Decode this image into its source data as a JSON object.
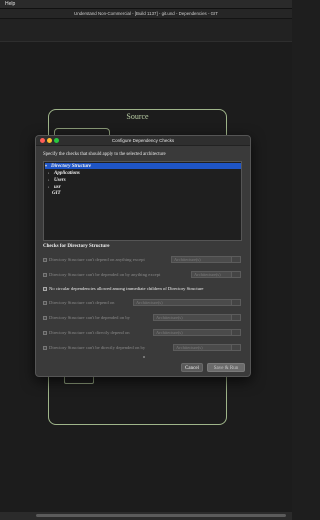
{
  "menubar": {
    "menu_help": "Help"
  },
  "window": {
    "title": "Understand Non-Commercial - [Build 1137] - git.und - Dependencies - GIT"
  },
  "canvas": {
    "source_label": "Source"
  },
  "dialog": {
    "title": "Configure Dependency Checks",
    "instruction": "Specify the checks that should apply to the selected architecture",
    "tree": [
      {
        "label": "Directory Structure",
        "expander": "▾",
        "selected": true
      },
      {
        "label": "Applications",
        "expander": "›",
        "selected": false
      },
      {
        "label": "Users",
        "expander": "›",
        "selected": false
      },
      {
        "label": "usr",
        "expander": "›",
        "selected": false
      },
      {
        "label": "GIT",
        "expander": "",
        "selected": false
      }
    ],
    "checks_title": "Checks for Directory Structure",
    "checks": [
      {
        "label": "Directory Structure can't depend on anything except",
        "enabled": false,
        "combo": "Architecture(s)"
      },
      {
        "label": "Directory Structure can't be depended on by anything except",
        "enabled": false,
        "combo": "Architecture(s)"
      },
      {
        "label": "No circular dependencies allowed among immediate children of Directory Structure",
        "enabled": true,
        "combo": ""
      },
      {
        "label": "Directory Structure can't depend on",
        "enabled": false,
        "combo": "Architecture(s)"
      },
      {
        "label": "Directory Structure can't be depended on by",
        "enabled": false,
        "combo": "Architecture(s)"
      },
      {
        "label": "Directory Structure can't directly depend on",
        "enabled": false,
        "combo": "Architecture(s)"
      },
      {
        "label": "Directory Structure can't be directly depended on by",
        "enabled": false,
        "combo": "Architecture(s)"
      }
    ],
    "cancel_label": "Cancel",
    "save_run_label": "Save & Run"
  }
}
